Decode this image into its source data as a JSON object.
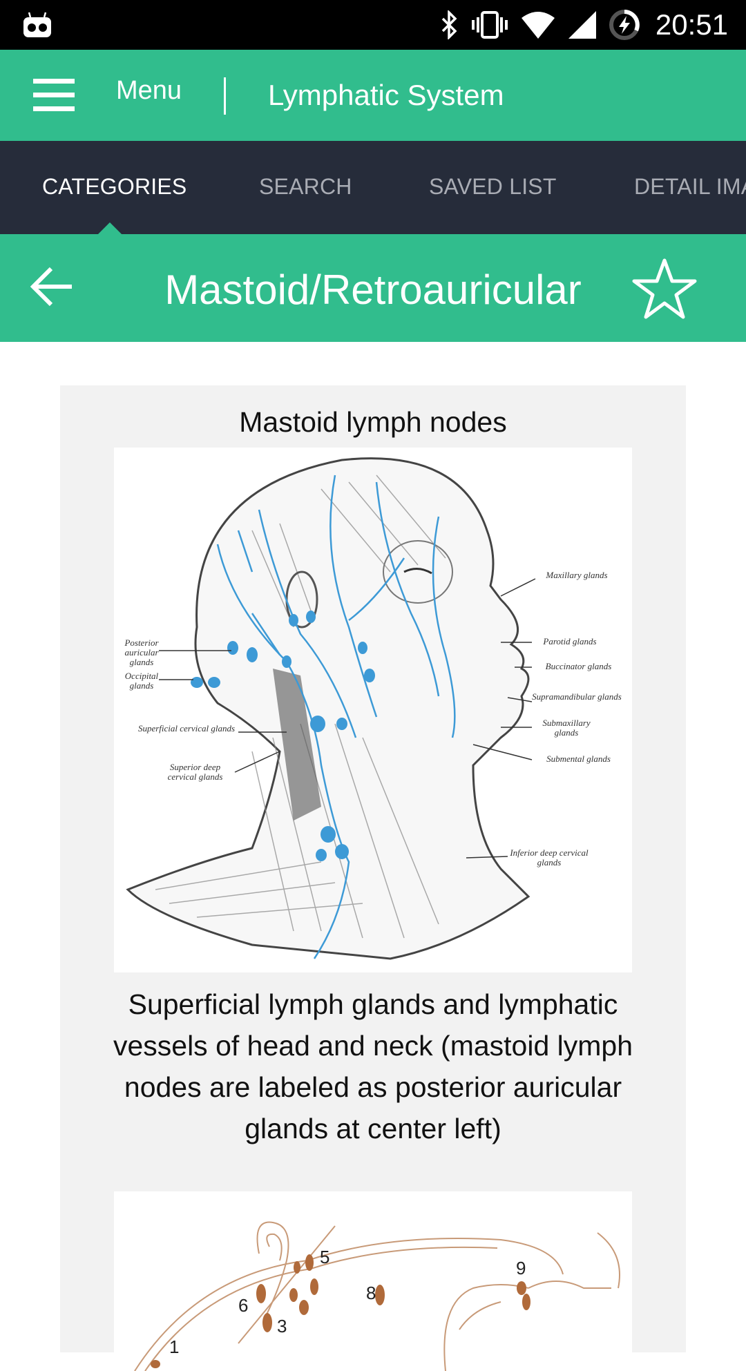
{
  "status_bar": {
    "left_icon": "cyanogenmod-icon",
    "icons": [
      "bluetooth-icon",
      "vibrate-icon",
      "wifi-icon",
      "cell-signal-icon",
      "battery-charging-icon"
    ],
    "time": "20:51"
  },
  "app_bar": {
    "menu_icon": "hamburger-icon",
    "menu_label": "Menu",
    "title": "Lymphatic System"
  },
  "tabs": [
    {
      "label": "CATEGORIES",
      "active": true
    },
    {
      "label": "SEARCH",
      "active": false
    },
    {
      "label": "SAVED LIST",
      "active": false
    },
    {
      "label": "DETAIL IMAGES",
      "active": false
    }
  ],
  "sub_header": {
    "back_icon": "arrow-left-icon",
    "title": "Mastoid/Retroauricular",
    "favorite_icon": "star-outline-icon"
  },
  "content": {
    "heading": "Mastoid lymph nodes",
    "figure1": {
      "description": "Illustration of head and neck with lymph vessels (blue)",
      "labels": {
        "maxillary": "Maxillary glands",
        "parotid": "Parotid glands",
        "buccinator": "Buccinator glands",
        "supramandibular": "Supramandibular glands",
        "submaxillary": "Submaxillary glands",
        "submental": "Submental glands",
        "posterior_auricular": "Posterior auricular glands",
        "occipital": "Occipital glands",
        "superficial_cervical": "Superficial cervical glands",
        "superior_deep_cervical": "Superior deep cervical glands",
        "inferior_deep_cervical": "Inferior deep cervical glands"
      }
    },
    "caption": "Superficial lymph glands and lymphatic vessels of head and neck (mastoid lymph nodes are labeled as posterior auricular glands at center left)",
    "figure2": {
      "description": "Numbered diagram of head lymph nodes (brown)",
      "numbers": [
        "1",
        "3",
        "5",
        "6",
        "8",
        "9"
      ]
    }
  },
  "colors": {
    "primary_green": "#31bd8d",
    "tab_bar_dark": "#262c3a",
    "card_background": "#f2f2f2",
    "lymph_blue": "#3d9ad6",
    "node_brown": "#b06a3a"
  }
}
